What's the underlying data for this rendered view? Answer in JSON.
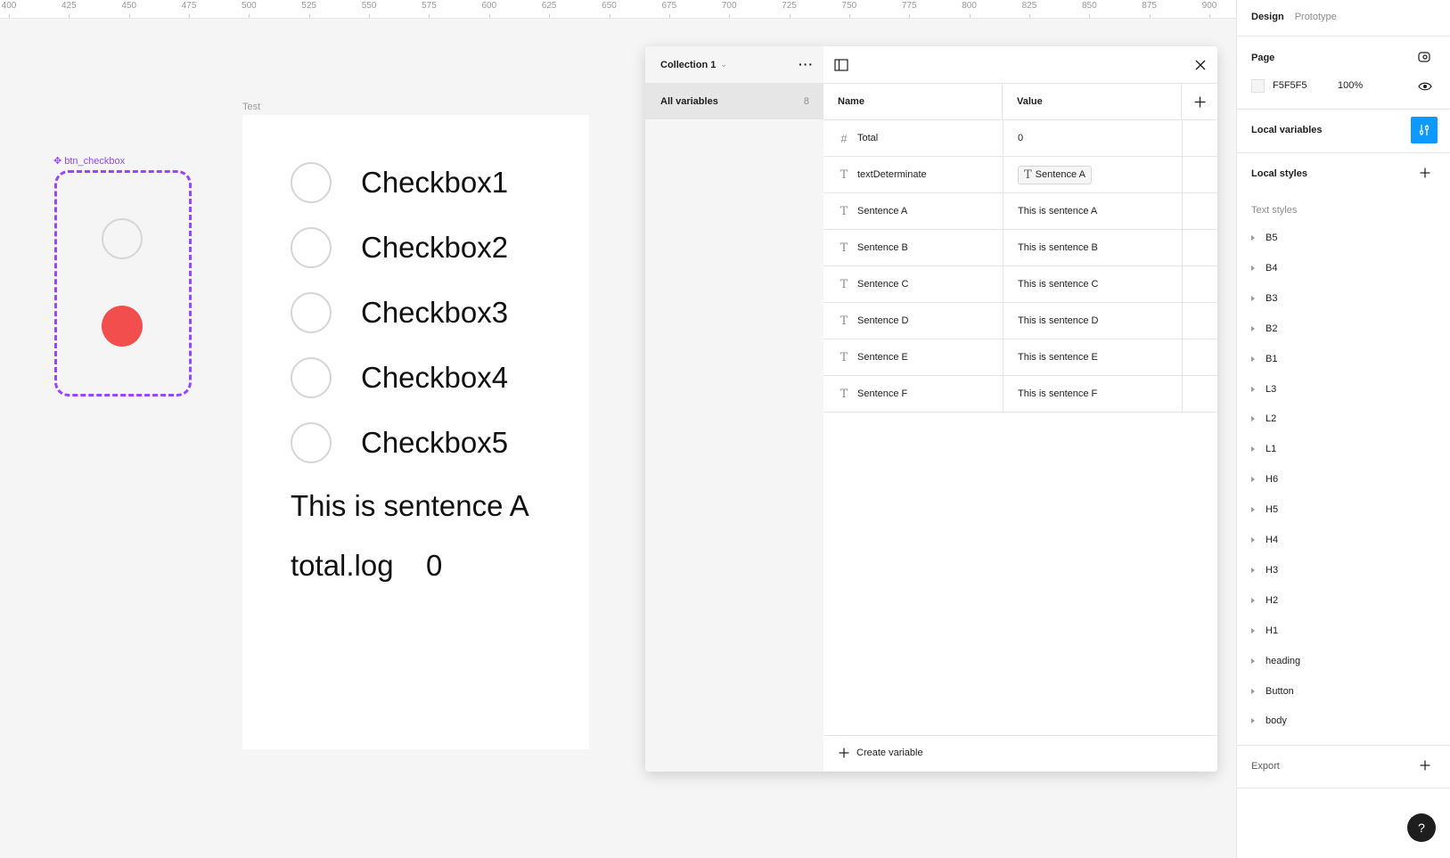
{
  "ruler": {
    "ticks": [
      "400",
      "425",
      "450",
      "475",
      "500",
      "525",
      "550",
      "575",
      "600",
      "625",
      "650",
      "675",
      "700",
      "725",
      "750",
      "775",
      "800",
      "825",
      "850",
      "875",
      "900"
    ]
  },
  "component": {
    "label": "btn_checkbox",
    "fill_color": "#f24e4e",
    "accent": "#9747ff"
  },
  "frame": {
    "label": "Test",
    "checkboxes": [
      "Checkbox1",
      "Checkbox2",
      "Checkbox3",
      "Checkbox4",
      "Checkbox5"
    ],
    "sentence": "This is sentence A",
    "total_label": "total.log",
    "total_value": "0"
  },
  "variables_panel": {
    "collection_name": "Collection 1",
    "all_variables_label": "All variables",
    "all_variables_count": "8",
    "columns": {
      "name": "Name",
      "value": "Value"
    },
    "rows": [
      {
        "type_icon": "#",
        "name": "Total",
        "value": "0",
        "is_alias": false
      },
      {
        "type_icon": "T",
        "name": "textDeterminate",
        "value": "Sentence A",
        "is_alias": true
      },
      {
        "type_icon": "T",
        "name": "Sentence A",
        "value": "This is sentence A",
        "is_alias": false
      },
      {
        "type_icon": "T",
        "name": "Sentence B",
        "value": "This is sentence B",
        "is_alias": false
      },
      {
        "type_icon": "T",
        "name": "Sentence C",
        "value": "This is sentence C",
        "is_alias": false
      },
      {
        "type_icon": "T",
        "name": "Sentence D",
        "value": "This is sentence D",
        "is_alias": false
      },
      {
        "type_icon": "T",
        "name": "Sentence E",
        "value": "This is sentence E",
        "is_alias": false
      },
      {
        "type_icon": "T",
        "name": "Sentence F",
        "value": "This is sentence F",
        "is_alias": false
      }
    ],
    "create_label": "Create variable"
  },
  "right_panel": {
    "tabs": {
      "design": "Design",
      "prototype": "Prototype"
    },
    "page": {
      "title": "Page",
      "color": "F5F5F5",
      "opacity": "100%"
    },
    "local_variables": "Local variables",
    "local_styles": "Local styles",
    "text_styles_title": "Text styles",
    "text_styles": [
      "B5",
      "B4",
      "B3",
      "B2",
      "B1",
      "L3",
      "L2",
      "L1",
      "H6",
      "H5",
      "H4",
      "H3",
      "H2",
      "H1",
      "heading",
      "Button",
      "body"
    ],
    "export": "Export",
    "help": "?",
    "accent": "#0d99ff"
  }
}
